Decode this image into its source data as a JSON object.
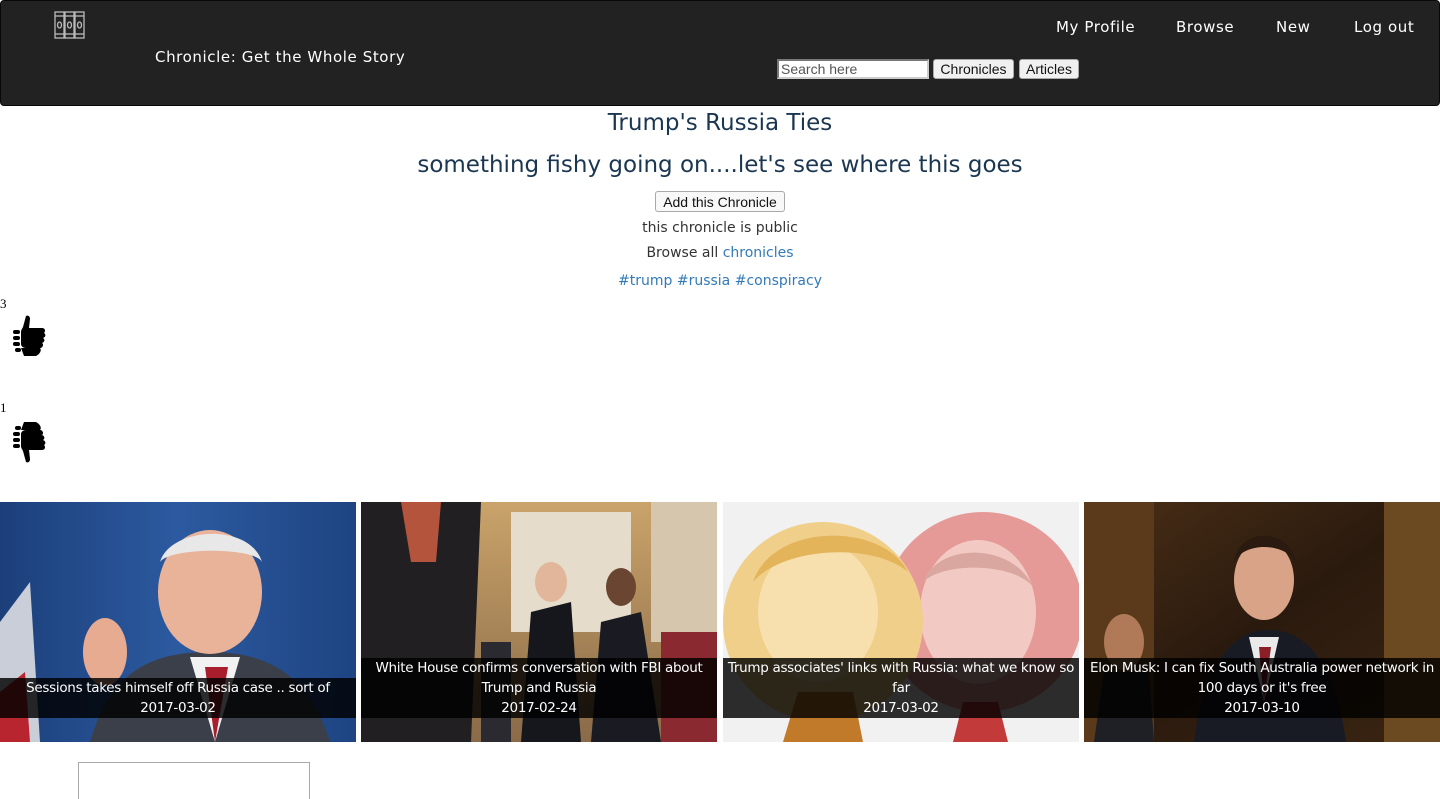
{
  "header": {
    "brand": "Chronicle: Get the Whole Story",
    "nav": {
      "profile": "My Profile",
      "browse": "Browse",
      "new": "New",
      "logout": "Log out"
    },
    "search": {
      "placeholder": "Search here",
      "value": "",
      "chronicles_button": "Chronicles",
      "articles_button": "Articles"
    },
    "logo_icon": "bookshelf-logo-icon"
  },
  "chronicle": {
    "title": "Trump's Russia Ties",
    "description": "something fishy going on....let's see where this goes",
    "add_button": "Add this Chronicle",
    "visibility": "this chronicle is public",
    "browse_prefix": "Browse all ",
    "browse_link": "chronicles",
    "tags": [
      "#trump",
      "#russia",
      "#conspiracy"
    ]
  },
  "votes": {
    "up_count": "3",
    "down_count": "1",
    "up_icon": "thumbs-up-icon",
    "down_icon": "thumbs-down-icon"
  },
  "articles": [
    {
      "title": "Sessions takes himself off Russia case .. sort of",
      "date": "2017-03-02"
    },
    {
      "title": "White House confirms conversation with FBI about Trump and Russia",
      "date": "2017-02-24"
    },
    {
      "title": "Trump associates' links with Russia: what we know so far",
      "date": "2017-03-02"
    },
    {
      "title": "Elon Musk: I can fix South Australia power network in 100 days or it's free",
      "date": "2017-03-10"
    }
  ],
  "comment": {
    "value": ""
  },
  "colors": {
    "navbar": "#222222",
    "link": "#337ab7",
    "heading": "#1a3650"
  }
}
